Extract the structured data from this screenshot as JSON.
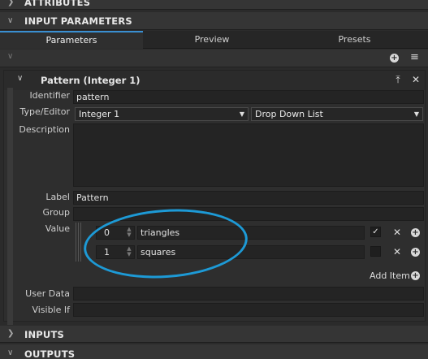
{
  "sections": {
    "attributes": "ATTRIBUTES",
    "input_parameters": "INPUT PARAMETERS",
    "inputs": "INPUTS",
    "outputs": "OUTPUTS"
  },
  "tabs": [
    "Parameters",
    "Preview",
    "Presets"
  ],
  "parameter": {
    "title": "Pattern (Integer 1)",
    "labels": {
      "identifier": "Identifier",
      "type_editor": "Type/Editor",
      "description": "Description",
      "label": "Label",
      "group": "Group",
      "value": "Value",
      "user_data": "User Data",
      "visible_if": "Visible If"
    },
    "identifier": "pattern",
    "type": "Integer 1",
    "editor": "Drop Down List",
    "description": "",
    "label": "Pattern",
    "group": "",
    "items": [
      {
        "index": "0",
        "name": "triangles",
        "checked": true
      },
      {
        "index": "1",
        "name": "squares",
        "checked": false
      }
    ],
    "add_item": "Add Item",
    "user_data": "",
    "visible_if": ""
  },
  "colors": {
    "annotation": "#1d9ad6",
    "active_tab": "#3a8fd1"
  }
}
